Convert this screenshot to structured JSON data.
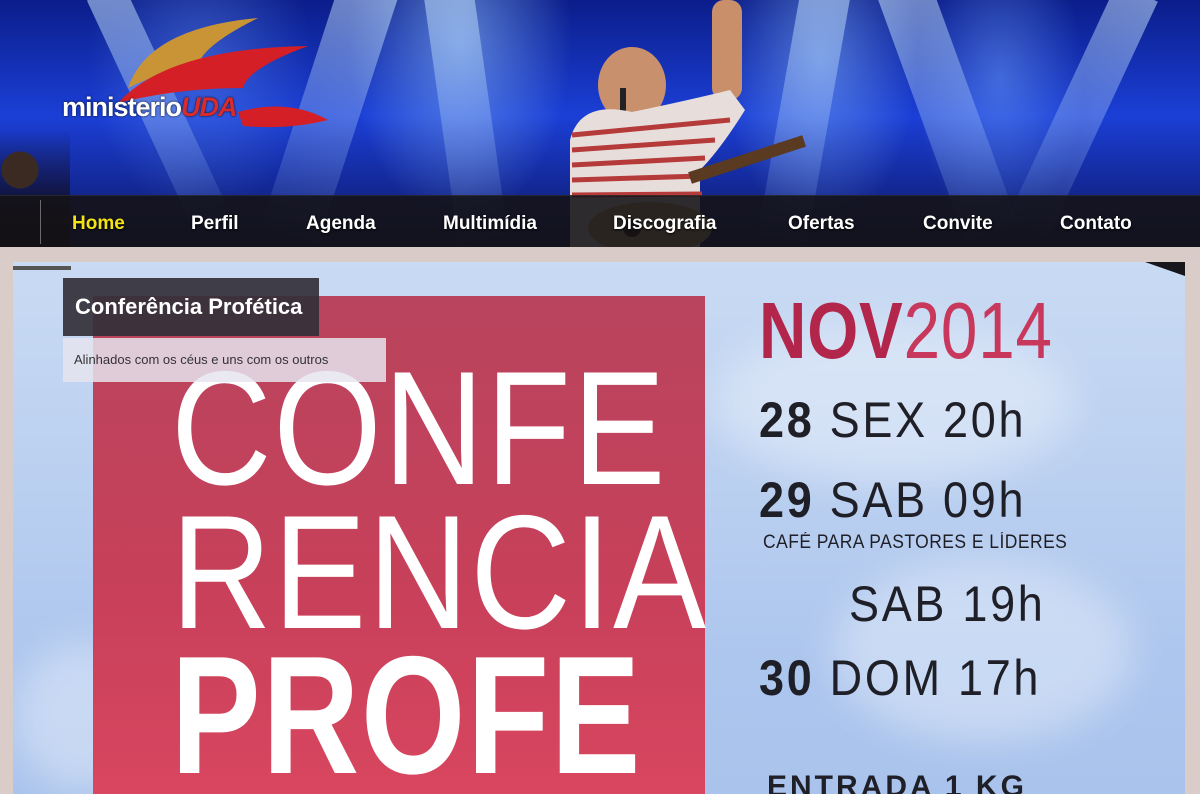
{
  "header": {
    "logo_text": "ministerio",
    "logo_accent": "UDA"
  },
  "nav": {
    "items": [
      {
        "label": "Home",
        "active": true
      },
      {
        "label": "Perfil",
        "active": false
      },
      {
        "label": "Agenda",
        "active": false
      },
      {
        "label": "Multimídia",
        "active": false
      },
      {
        "label": "Discografia",
        "active": false
      },
      {
        "label": "Ofertas",
        "active": false
      },
      {
        "label": "Convite",
        "active": false
      },
      {
        "label": "Contato",
        "active": false
      }
    ]
  },
  "slide": {
    "caption_title": "Conferência Profética",
    "caption_subtitle": "Alinhados com os céus e uns com os outros",
    "poster": {
      "line1": "CONFE",
      "line2": "RENCIA",
      "line3": "PROFE",
      "month": "NOV",
      "year": "2014",
      "schedule": [
        {
          "day": "28",
          "text": "SEX 20h"
        },
        {
          "day": "29",
          "text": "SAB 09h"
        },
        {
          "day": "",
          "text": "SAB 19h"
        },
        {
          "day": "30",
          "text": "DOM 17h"
        }
      ],
      "note": "CAFÉ PARA PASTORES E LÍDERES",
      "entrada": "ENTRADA 1 KG"
    }
  },
  "colors": {
    "nav_active": "#f3e316",
    "poster_pink": "#c8405a",
    "month_red": "#b2264c"
  }
}
